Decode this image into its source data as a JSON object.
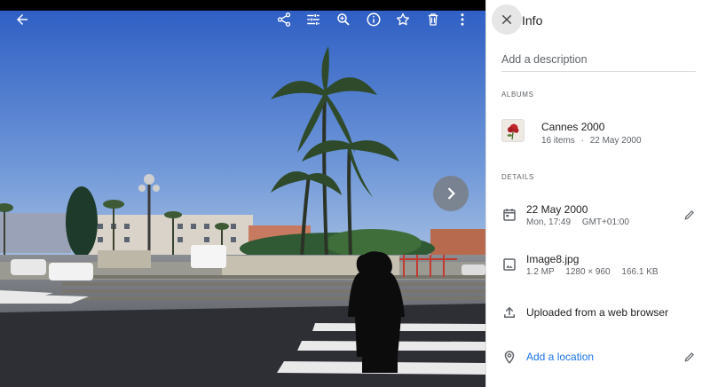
{
  "viewer": {
    "toolbar": {
      "back_icon": "arrow-back-icon",
      "share_icon": "share-icon",
      "edit_icon": "tune-icon",
      "zoom_icon": "zoom-in-icon",
      "info_icon": "info-icon",
      "favorite_icon": "star-icon",
      "delete_icon": "trash-icon",
      "more_icon": "more-vert-icon"
    },
    "next_icon": "chevron-right-icon"
  },
  "panel": {
    "title": "Info",
    "description_placeholder": "Add a description",
    "albums_heading": "ALBUMS",
    "album": {
      "name": "Cannes 2000",
      "items": "16 items",
      "separator": "·",
      "date": "22 May 2000"
    },
    "details_heading": "DETAILS",
    "date_taken": "22 May 2000",
    "time": "Mon, 17:49",
    "timezone": "GMT+01:00",
    "file_name": "Image8.jpg",
    "megapixels": "1.2 MP",
    "resolution": "1280 × 960",
    "file_size": "166.1 KB",
    "upload_source": "Uploaded from a web browser",
    "location_link": "Add a location"
  },
  "colors": {
    "link": "#1a73e8",
    "sky_top": "#2f5fc4",
    "sky_bottom": "#8fb1de"
  }
}
